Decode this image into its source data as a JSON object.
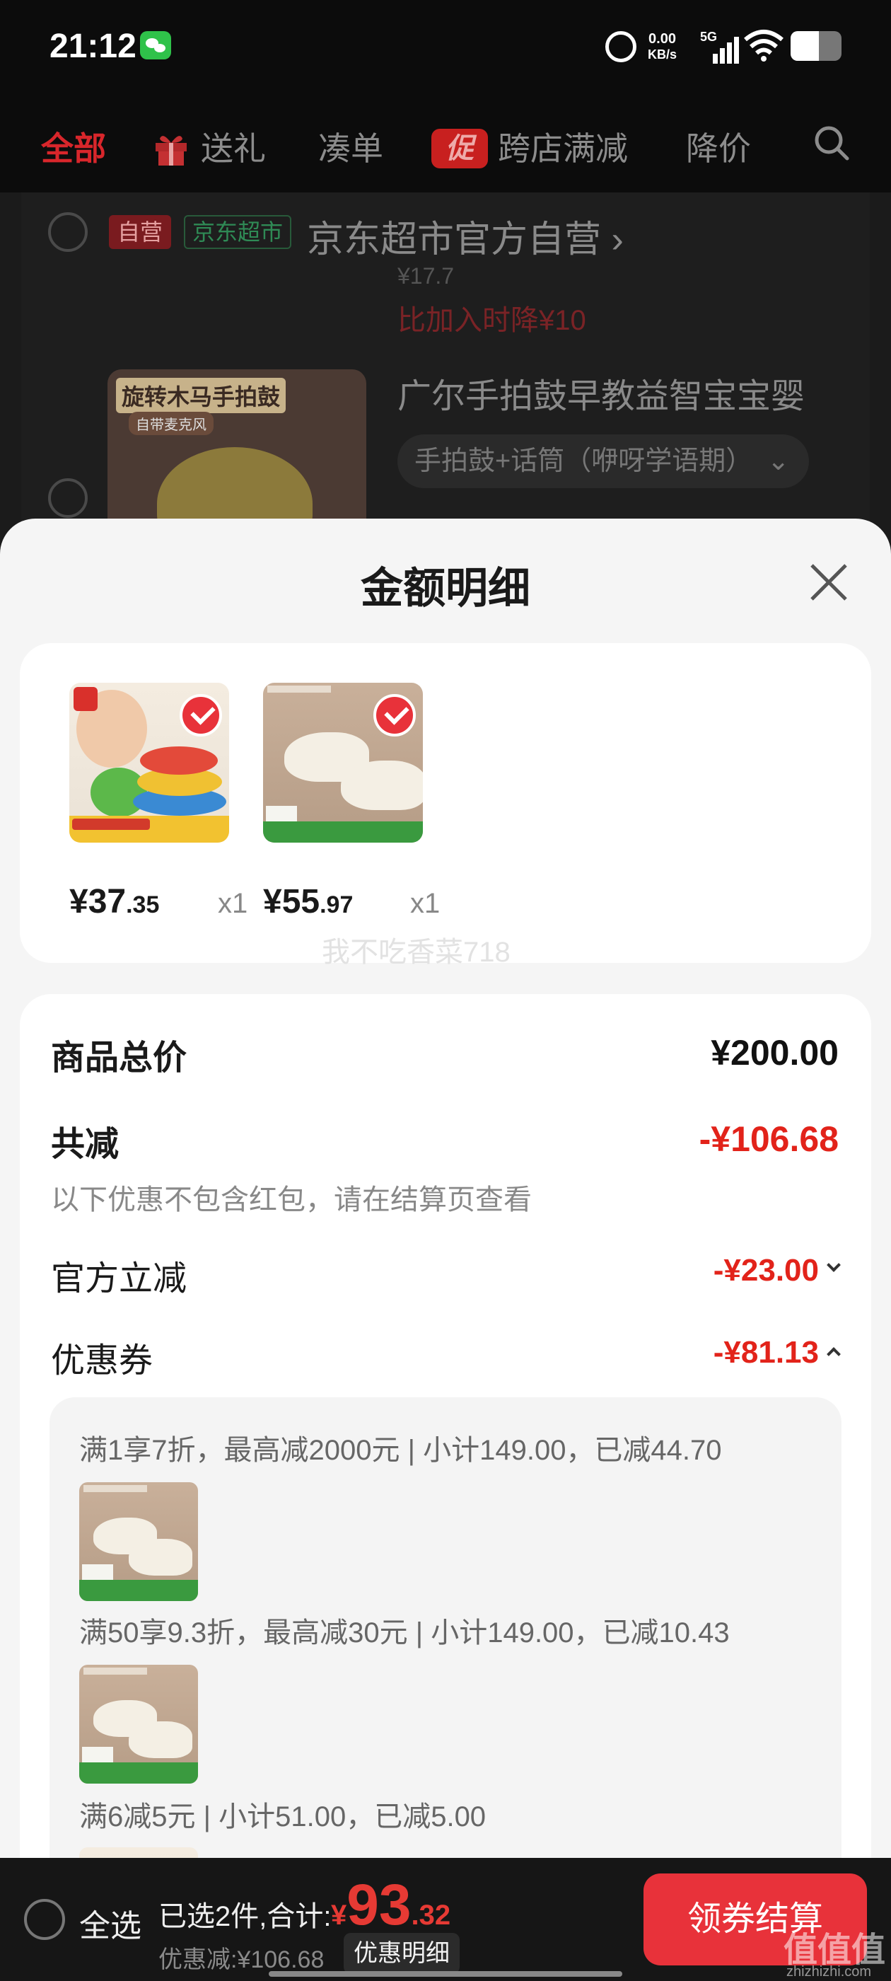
{
  "status_bar": {
    "time": "21:12",
    "net_speed_value": "0.00",
    "net_speed_unit": "KB/s",
    "network": "5G",
    "icons": [
      "wechat-icon",
      "alarm-icon",
      "signal-icon",
      "wifi-icon",
      "battery-icon"
    ]
  },
  "top_nav": {
    "tabs": [
      {
        "label": "全部",
        "active": true
      },
      {
        "label": "送礼",
        "icon": "gift-icon"
      },
      {
        "label": "凑单"
      },
      {
        "label": "跨店满减",
        "icon": "promo-icon",
        "icon_text": "促"
      },
      {
        "label": "降价"
      }
    ],
    "search_icon": "search-icon"
  },
  "background_cart": {
    "store": {
      "badge_self": "自营",
      "badge_market": "京东超市",
      "name": "京东超市官方自营",
      "arrow": "›"
    },
    "price_faded": "¥17.7",
    "price_drop_note": "比加入时降¥10",
    "product": {
      "image_label": "旋转木马手拍鼓",
      "image_sub": "自带麦克风",
      "title": "广尔手拍鼓早教益智宝宝婴",
      "spec": "手拍鼓+话筒（咿呀学语期）",
      "spec_arrow": "⌄"
    }
  },
  "sheet": {
    "title": "金额明细",
    "close_icon": "close-icon",
    "goods": [
      {
        "image": "toy-image",
        "price_int": "¥37",
        "price_dec": ".35",
        "qty": "x1",
        "checked": true
      },
      {
        "image": "shoe-image",
        "price_int": "¥55",
        "price_dec": ".97",
        "qty": "x1",
        "checked": true
      }
    ],
    "watermark": "我不吃香菜718",
    "summary": {
      "total_label": "商品总价",
      "total_value": "¥200.00",
      "reduce_label": "共减",
      "reduce_value": "-¥106.68",
      "reduce_note": "以下优惠不包含红包，请在结算页查看",
      "official_label": "官方立减",
      "official_value": "-¥23.00",
      "coupon_label": "优惠券",
      "coupon_value": "-¥81.13"
    },
    "coupons": [
      {
        "text": "满1享7折，最高减2000元 | 小计149.00，已减44.70"
      },
      {
        "text": "满50享9.3折，最高减30元 | 小计149.00，已减10.43"
      },
      {
        "text": "满6减5元 | 小计51.00，已减5.00"
      }
    ]
  },
  "checkout": {
    "select_all": "全选",
    "summary": "已选2件,合计:",
    "total_currency": "¥",
    "total_int": "93",
    "total_dec": ".32",
    "discount": "优惠减:¥106.68",
    "detail_button": "优惠明细",
    "pay_button": "领券结算"
  },
  "site_watermark": {
    "mark": "值值值",
    "url": "zhizhizhi.com"
  },
  "colors": {
    "accent_red": "#e2231a",
    "button_red": "#e8323a",
    "sheet_bg": "#f5f5f5"
  }
}
